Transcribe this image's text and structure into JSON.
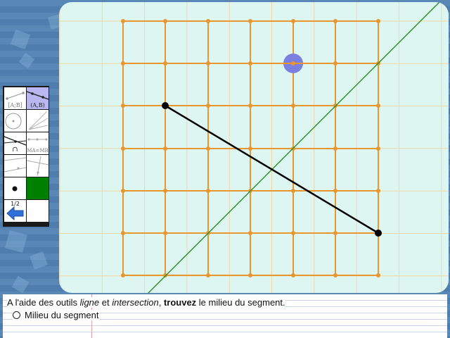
{
  "colors": {
    "background": "#5a88b6",
    "board": "#ddf6f1",
    "grid_fine": "#f0d9a8",
    "grid_main": "#e8962f",
    "segment": "#000000",
    "construction_line": "#2a8f2a",
    "cursor": "#7b7fe0",
    "fill_tool": "#008000"
  },
  "toolbox": {
    "tools": [
      {
        "name": "segment-tool",
        "label": "[A;B]"
      },
      {
        "name": "line-tool",
        "label": "(A,B)"
      },
      {
        "name": "circle-tool",
        "label": ""
      },
      {
        "name": "ray-tool",
        "label": ""
      },
      {
        "name": "intersection-tool",
        "label": "∩"
      },
      {
        "name": "equal-distance-tool",
        "label": "MA=MB"
      },
      {
        "name": "parallel-tool",
        "label": ""
      },
      {
        "name": "perpendicular-tool",
        "label": ""
      },
      {
        "name": "point-tool",
        "label": ""
      },
      {
        "name": "color-tool",
        "label": ""
      }
    ],
    "page_indicator": "1/2"
  },
  "instructions": {
    "part1": "A l'aide des outils ",
    "italic1": "ligne",
    "part2": " et ",
    "italic2": "intersection",
    "part3": ", ",
    "bold": "trouvez",
    "part4": " le milieu du segment.",
    "answer_label": "Milieu du segment"
  }
}
